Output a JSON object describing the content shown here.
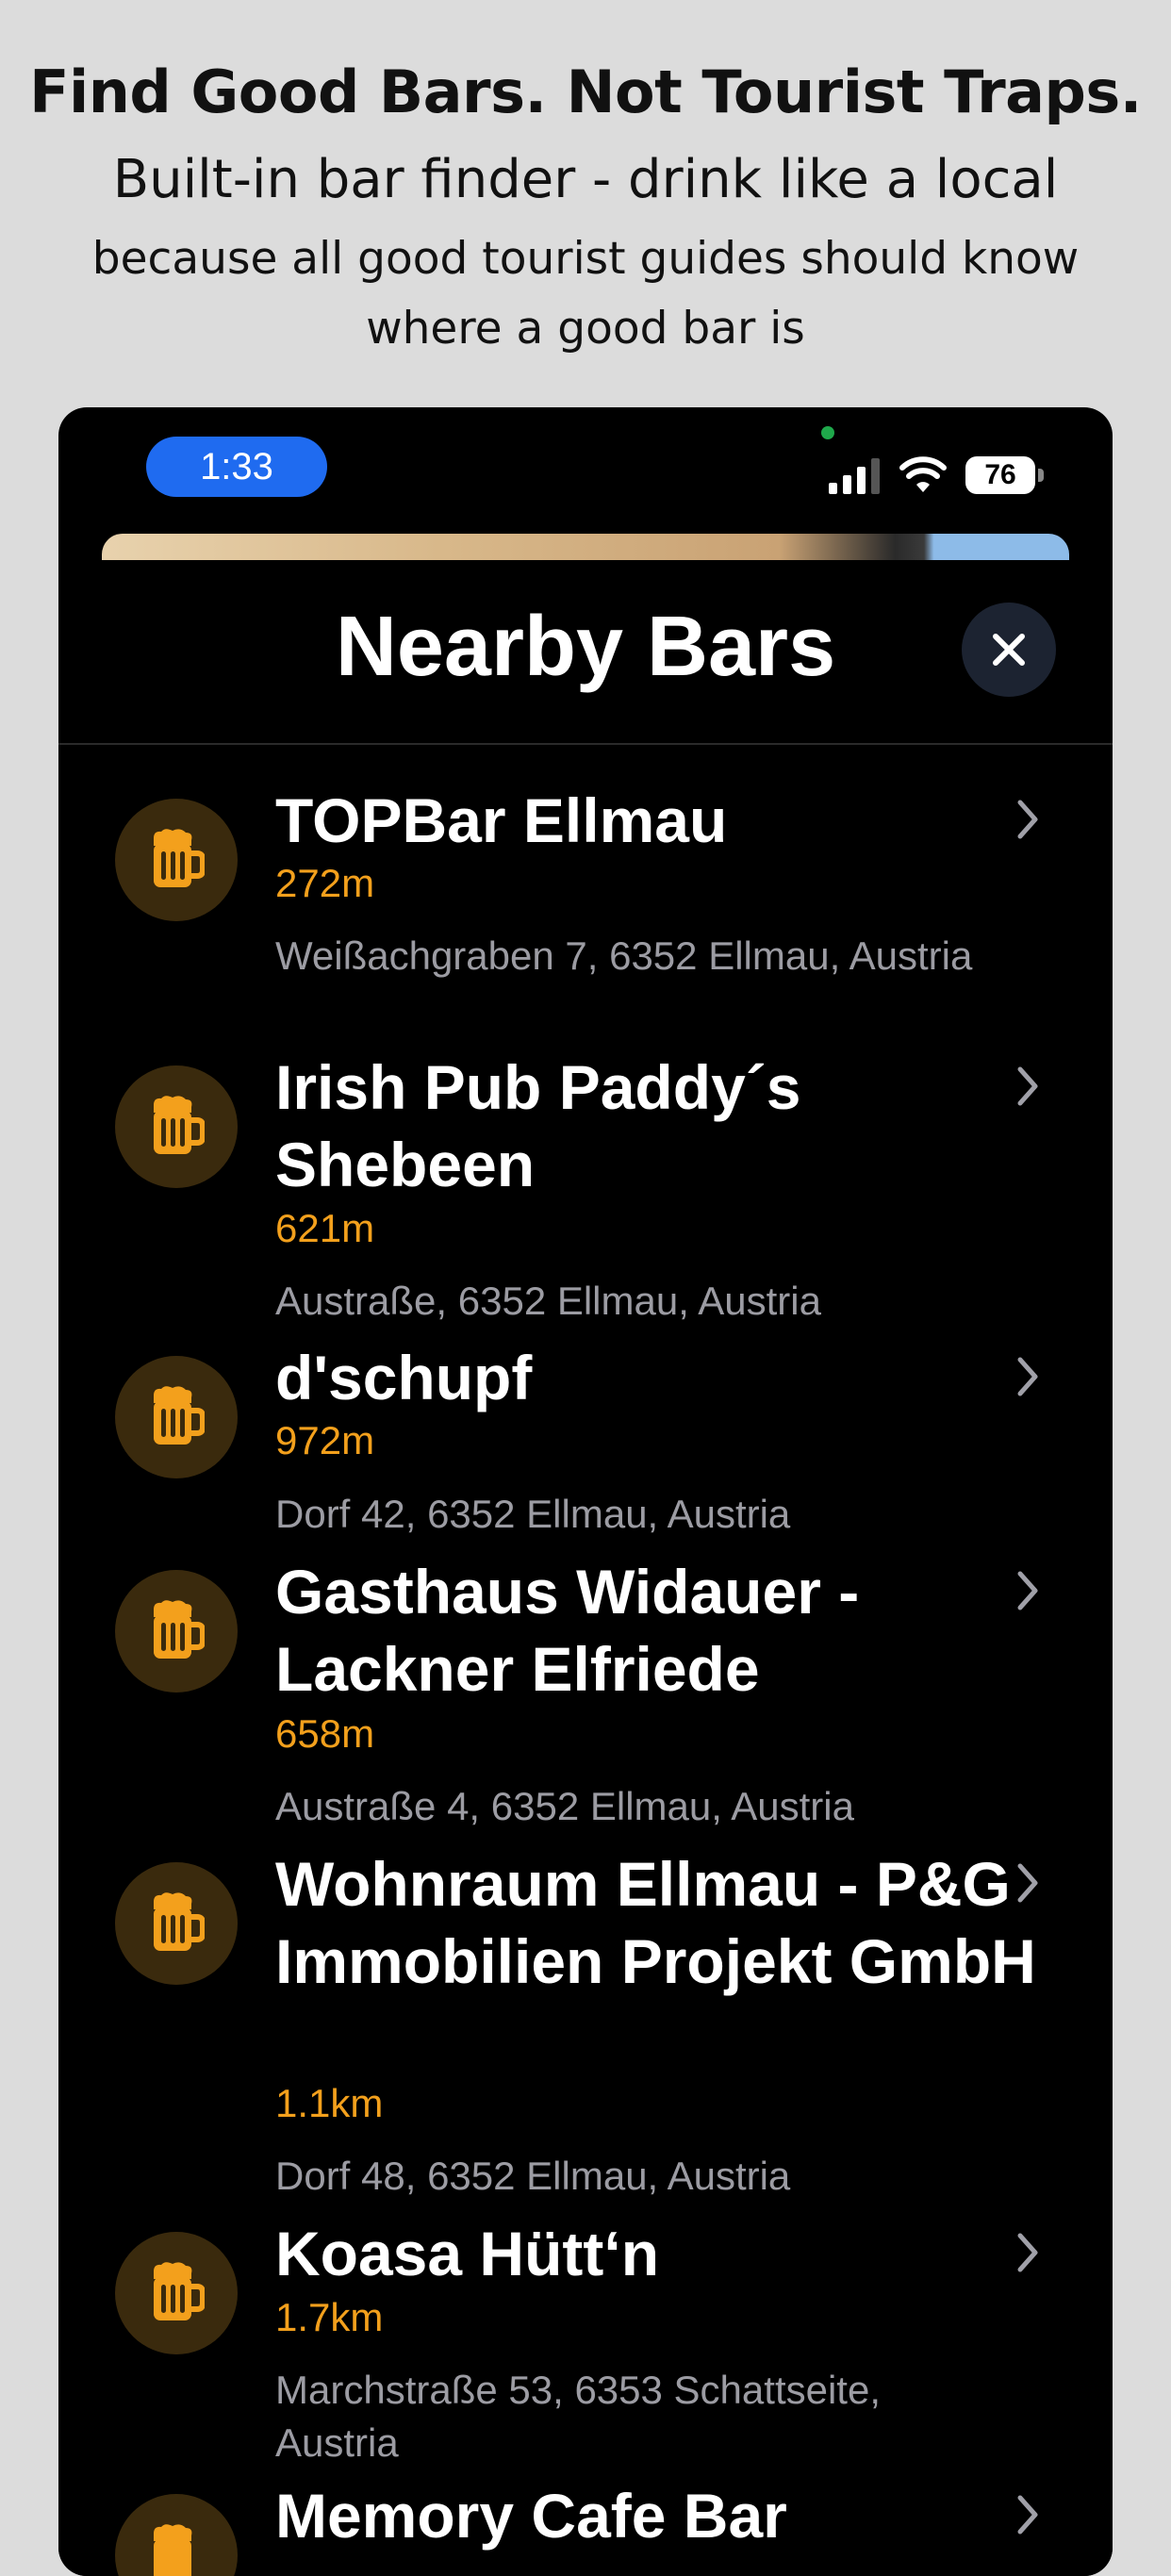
{
  "promo": {
    "title": "Find Good Bars. Not Tourist Traps.",
    "subtitle": "Built-in bar finder  - drink like a local",
    "desc_line1": "because all good tourist guides should know",
    "desc_line2": "where a good bar is"
  },
  "status_bar": {
    "time": "1:33",
    "battery": "76"
  },
  "sheet": {
    "title": "Nearby Bars",
    "close_icon": "close-icon"
  },
  "colors": {
    "accent": "#f3a01c",
    "background": "#000000",
    "badge_bg": "#3a2a0d",
    "page_bg": "#dcdcdc",
    "time_pill": "#1f6bf0"
  },
  "bars": [
    {
      "name": "TOPBar Ellmau",
      "distance": "272m",
      "address": "Weißachgraben 7, 6352 Ellmau, Austria",
      "icon": "beer-mug-icon"
    },
    {
      "name": "Irish Pub Paddy´s Shebeen",
      "distance": "621m",
      "address": "Austraße, 6352 Ellmau, Austria",
      "icon": "beer-mug-icon"
    },
    {
      "name": "d'schupf",
      "distance": "972m",
      "address": "Dorf 42, 6352 Ellmau, Austria",
      "icon": "beer-mug-icon"
    },
    {
      "name": "Gasthaus Widauer - Lackner Elfriede",
      "distance": "658m",
      "address": "Austraße 4, 6352 Ellmau, Austria",
      "icon": "beer-mug-icon"
    },
    {
      "name": "Wohnraum Ellmau - P&G Immobilien Projekt GmbH",
      "distance": "1.1km",
      "address": "Dorf 48, 6352 Ellmau, Austria",
      "icon": "beer-mug-icon"
    },
    {
      "name": "Koasa Hütt‘n",
      "distance": "1.7km",
      "address": "Marchstraße 53, 6353 Schattseite, Austria",
      "icon": "beer-mug-icon"
    },
    {
      "name": "Memory Cafe Bar",
      "distance": "",
      "address": "",
      "icon": "beer-mug-icon"
    }
  ]
}
